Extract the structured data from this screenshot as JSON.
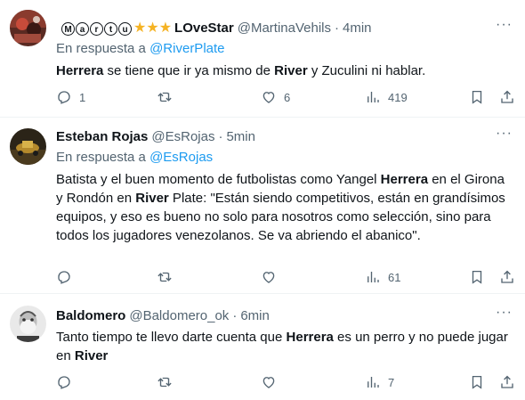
{
  "tweets": [
    {
      "circled_letters": [
        "M",
        "a",
        "r",
        "t",
        "u"
      ],
      "stars": "★★★",
      "name": "LOveStar",
      "handle": "@MartinaVehils",
      "sep": "·",
      "time": "4min",
      "reply_prefix": "En respuesta a",
      "reply_mention": "@RiverPlate",
      "text_parts": [
        "Herrera",
        " se tiene que ir ya mismo de ",
        "River",
        " y Zuculini ni hablar."
      ],
      "counts": {
        "replies": "1",
        "retweets": "",
        "likes": "6",
        "views": "419"
      }
    },
    {
      "name": "Esteban Rojas",
      "handle": "@EsRojas",
      "sep": "·",
      "time": "5min",
      "reply_prefix": "En respuesta a",
      "reply_mention": "@EsRojas",
      "text_parts": [
        "Batista y el buen momento de futbolistas como Yangel ",
        "Herrera",
        " en el Girona y Rondón en ",
        "River",
        " Plate: \"Están siendo competitivos, están en grandísimos equipos, y eso es bueno no solo para nosotros como selección, sino para todos los jugadores venezolanos. Se va abriendo el abanico\"."
      ],
      "counts": {
        "replies": "",
        "retweets": "",
        "likes": "",
        "views": "61"
      }
    },
    {
      "name": "Baldomero",
      "handle": "@Baldomero_ok",
      "sep": "·",
      "time": "6min",
      "text_parts": [
        "Tanto tiempo te llevo darte cuenta que ",
        "Herrera",
        " es un perro y no puede jugar en ",
        "River"
      ],
      "counts": {
        "replies": "",
        "retweets": "",
        "likes": "",
        "views": "7"
      }
    }
  ],
  "icons": {
    "more": "more-icon",
    "reply": "reply-icon",
    "retweet": "retweet-icon",
    "like": "like-icon",
    "views": "views-icon",
    "bookmark": "bookmark-icon",
    "share": "share-icon"
  },
  "colors": {
    "text": "#0f1419",
    "secondary": "#536471",
    "link": "#1d9bf0",
    "stars": "#f5b324",
    "divider": "#eff3f4"
  }
}
